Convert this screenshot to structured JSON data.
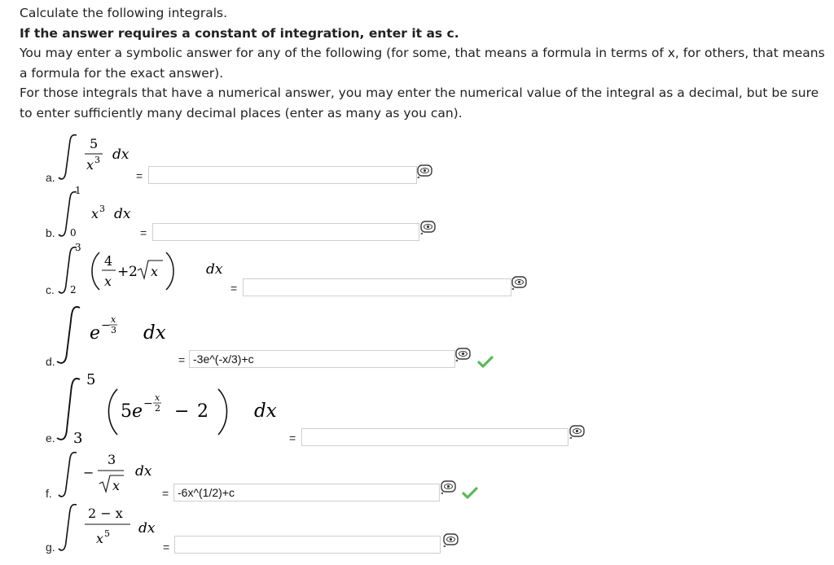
{
  "intro": {
    "line1": "Calculate the following integrals.",
    "line2": "If the answer requires a constant of integration, enter it as c.",
    "line3": "You may enter a symbolic answer for any of the following (for some, that means a formula in terms of x, for others, that means a formula for the exact answer).",
    "line4": "For those integrals that have a numerical answer, you may enter the numerical value of the integral as a decimal, but be sure to enter sufficiently many decimal places (enter as many as you can)."
  },
  "equals": "=",
  "problems": [
    {
      "letter": "a.",
      "answer": "",
      "correct": false
    },
    {
      "letter": "b.",
      "answer": "",
      "correct": false
    },
    {
      "letter": "c.",
      "answer": "",
      "correct": false
    },
    {
      "letter": "d.",
      "answer": "-3e^(-x/3)+c",
      "correct": true
    },
    {
      "letter": "e.",
      "answer": "",
      "correct": false
    },
    {
      "letter": "f.",
      "answer": "-6x^(1/2)+c",
      "correct": true
    },
    {
      "letter": "g.",
      "answer": "",
      "correct": false
    }
  ],
  "math": {
    "a": {
      "num": "5",
      "den": "x",
      "den_exp": "3",
      "dx": "dx"
    },
    "b": {
      "lower": "0",
      "upper": "1",
      "base": "x",
      "exp": "3",
      "dx": "dx"
    },
    "c": {
      "lower": "2",
      "upper": "3",
      "num": "4",
      "den": "x",
      "plus": "+",
      "coef": "2",
      "rad": "x",
      "dx": "dx"
    },
    "d": {
      "base": "e",
      "exp": "−",
      "exp_num": "x",
      "exp_den": "3",
      "dx": "dx"
    },
    "e": {
      "lower": "3",
      "upper": "5",
      "coef": "5",
      "base": "e",
      "exp": "−",
      "exp_num": "x",
      "exp_den": "2",
      "minus": "−",
      "const": "2",
      "dx": "dx"
    },
    "f": {
      "minus": "−",
      "num": "3",
      "rad": "x",
      "dx": "dx"
    },
    "g": {
      "num": "2 − x",
      "den": "x",
      "den_exp": "5",
      "dx": "dx"
    }
  },
  "colors": {
    "check": "#5cb85c",
    "border": "#cfcfcf",
    "icon": "#3a3a3a"
  },
  "icons": {
    "preview": "eye-preview-icon",
    "correct": "checkmark-icon"
  }
}
